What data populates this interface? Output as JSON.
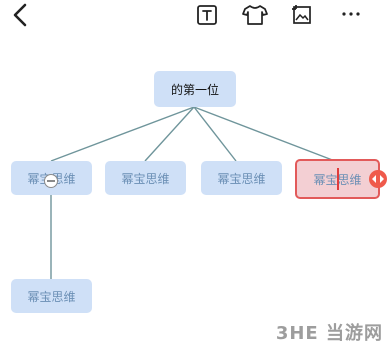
{
  "toolbar": {
    "back_icon": "chevron-left-icon",
    "text_icon": "text-box-icon",
    "style_icon": "shirt-icon",
    "image_icon": "image-icon",
    "more_icon": "more-horizontal-icon"
  },
  "mindmap": {
    "root": {
      "label": "的第一位"
    },
    "children": [
      {
        "label": "幂宝思维"
      },
      {
        "label": "幂宝思维"
      },
      {
        "label": "幂宝思维"
      },
      {
        "label": "幂宝思维"
      }
    ],
    "grandchild": {
      "label": "幂宝思维"
    }
  },
  "watermark": {
    "text": "3HE 当游网"
  },
  "colors": {
    "node_bg": "#cfe0f7",
    "node_text": "#6b8fb5",
    "selected_border": "#e25a5a",
    "connector": "#6f959b",
    "handle": "#ef5a4b"
  }
}
